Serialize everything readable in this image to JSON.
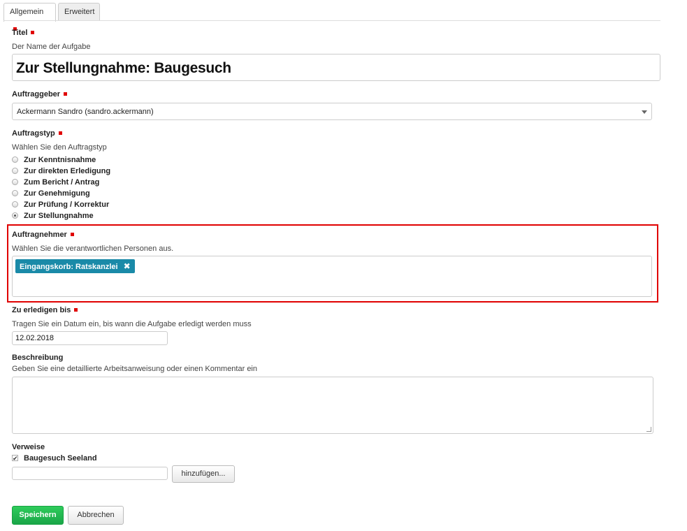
{
  "tabs": [
    {
      "label": "Allgemein",
      "active": true,
      "required": true
    },
    {
      "label": "Erweitert",
      "active": false
    }
  ],
  "title_field": {
    "label": "Titel",
    "help": "Der Name der Aufgabe",
    "value": "Zur Stellungnahme: Baugesuch"
  },
  "issuer_field": {
    "label": "Auftraggeber",
    "value": "Ackermann Sandro (sandro.ackermann)"
  },
  "task_type_field": {
    "label": "Auftragstyp",
    "help": "Wählen Sie den Auftragstyp",
    "options": [
      {
        "label": "Zur Kenntnisnahme",
        "checked": false
      },
      {
        "label": "Zur direkten Erledigung",
        "checked": false
      },
      {
        "label": "Zum Bericht / Antrag",
        "checked": false
      },
      {
        "label": "Zur Genehmigung",
        "checked": false
      },
      {
        "label": "Zur Prüfung / Korrektur",
        "checked": false
      },
      {
        "label": "Zur Stellungnahme",
        "checked": true
      }
    ]
  },
  "responsible_field": {
    "label": "Auftragnehmer",
    "help": "Wählen Sie die verantwortlichen Personen aus.",
    "tags": [
      "Eingangskorb: Ratskanzlei"
    ],
    "highlight_color": "#e00000",
    "tag_color": "#1a8aa8"
  },
  "deadline_field": {
    "label": "Zu erledigen bis",
    "help": "Tragen Sie ein Datum ein, bis wann die Aufgabe erledigt werden muss",
    "value": "12.02.2018"
  },
  "description_field": {
    "label": "Beschreibung",
    "help": "Geben Sie eine detaillierte Arbeitsanweisung oder einen Kommentar ein",
    "value": ""
  },
  "references_field": {
    "label": "Verweise",
    "items": [
      {
        "label": "Baugesuch Seeland",
        "checked": true
      }
    ],
    "input_value": "",
    "add_button": "hinzufügen..."
  },
  "actions": {
    "save": "Speichern",
    "cancel": "Abbrechen",
    "save_color": "#1fb34f"
  }
}
